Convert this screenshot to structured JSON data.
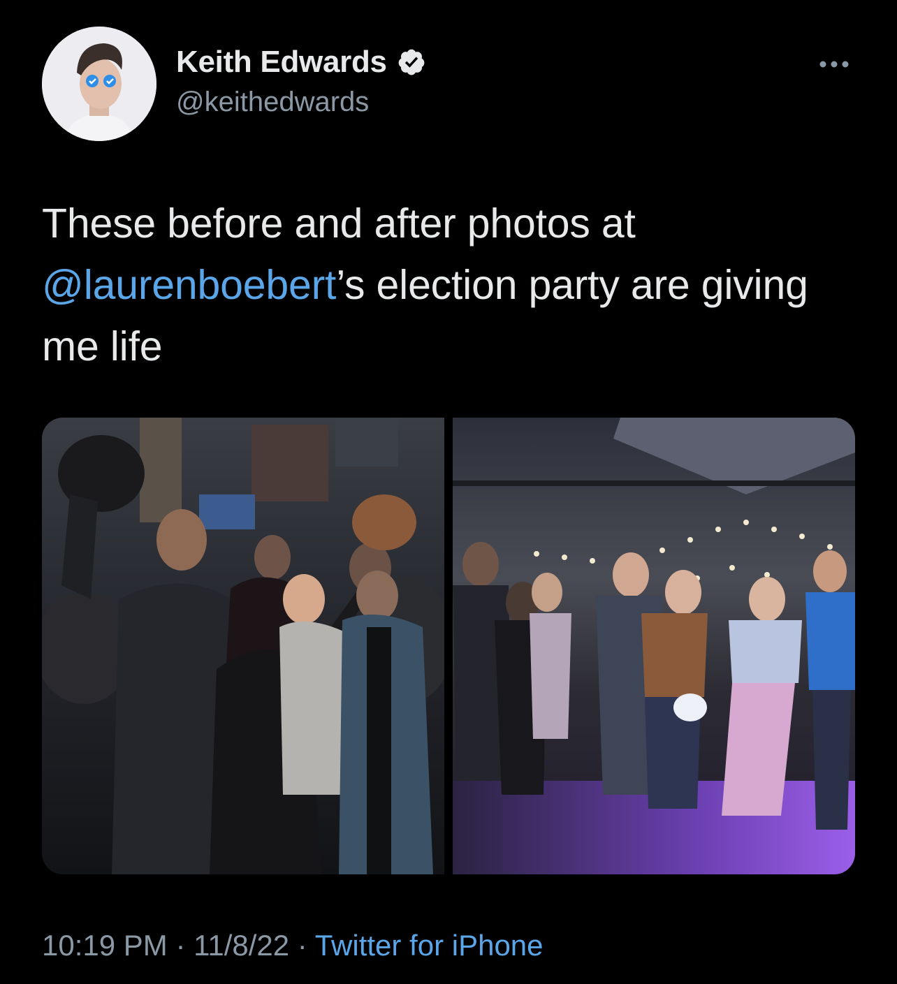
{
  "author": {
    "display_name": "Keith Edwards",
    "handle": "@keithedwards",
    "verified": true,
    "avatar_icon": "avatar-photo"
  },
  "tweet": {
    "text_before": "These before and after photos at ",
    "mention": "@laurenboebert",
    "text_after": "’s election party are giving me life"
  },
  "media": [
    {
      "icon": "photo-before"
    },
    {
      "icon": "photo-after"
    }
  ],
  "footer": {
    "time": "10:19 PM",
    "sep1": " · ",
    "date": "11/8/22",
    "sep2": " · ",
    "source": "Twitter for iPhone"
  },
  "colors": {
    "background": "#000000",
    "text": "#e7e9ea",
    "secondary": "#8b98a5",
    "link": "#5aa6e8",
    "verified_badge": "#e7e9ea"
  }
}
